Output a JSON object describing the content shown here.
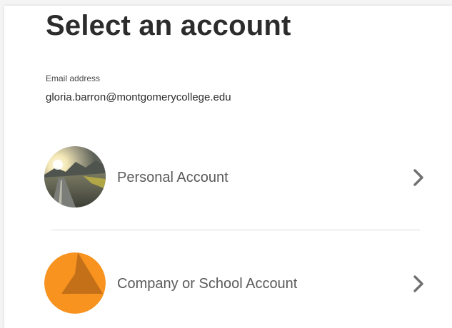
{
  "page": {
    "title": "Select an account",
    "email_label": "Email address",
    "email_value": "gloria.barron@montgomerycollege.edu"
  },
  "accounts": [
    {
      "label": "Personal Account",
      "avatar_icon": "landscape-photo-avatar",
      "chevron_icon": "chevron-right-icon"
    },
    {
      "label": "Company or School Account",
      "avatar_icon": "adobe-logo-avatar",
      "chevron_icon": "chevron-right-icon",
      "avatar_color": "#f7931e"
    }
  ],
  "colors": {
    "title": "#2c2c2c",
    "label": "#5a5a5a",
    "chevron": "#707070",
    "divider": "#dadada",
    "company_accent": "#f7931e"
  }
}
